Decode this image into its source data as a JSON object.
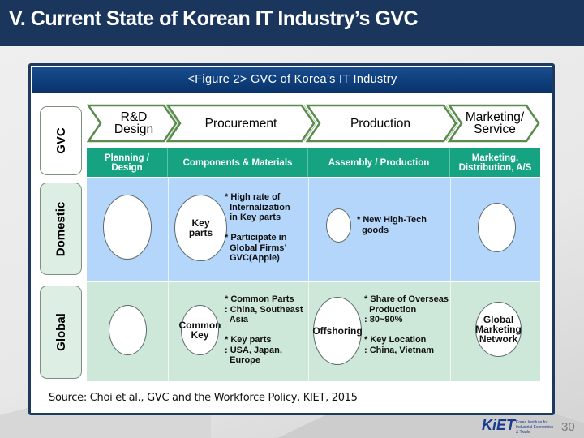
{
  "slide": {
    "title": "V. Current State of Korean IT Industry’s GVC",
    "page_number": "30"
  },
  "figure": {
    "title": "<Figure 2> GVC of Korea’s IT Industry",
    "row_labels": {
      "gvc": "GVC",
      "domestic": "Domestic",
      "global": "Global"
    },
    "stages": [
      {
        "label": "R&D\nDesign"
      },
      {
        "label": "Procurement"
      },
      {
        "label": "Production"
      },
      {
        "label": "Marketing/\nService"
      }
    ],
    "column_headers": [
      "Planning /\nDesign",
      "Components & Materials",
      "Assembly / Production",
      "Marketing,\nDistribution, A/S"
    ],
    "domestic": {
      "procurement_ellipse": "Key\nparts",
      "procurement_note": "* High rate of\n  Internalization\n  in Key parts\n\n* Participate in\n  Global Firms’\n  GVC(Apple)",
      "production_note": "* New High-Tech\n  goods"
    },
    "global": {
      "procurement_ellipse": "Common\nKey",
      "procurement_note": "* Common Parts\n: China, Southeast\n  Asia\n\n* Key parts\n: USA, Japan,\n  Europe",
      "production_ellipse": "Offshoring",
      "production_note": "* Share of Overseas\n  Production\n: 80~90%\n\n* Key Location\n: China, Vietnam",
      "marketing_ellipse": "Global\nMarketing\nNetwork"
    },
    "source": "Source: Choi et al., GVC and the Workforce Policy, KIET, 2015"
  },
  "logo": {
    "name": "KiET",
    "subtitle": "Korea Institute for Industrial Economics & Trade"
  },
  "colors": {
    "title_bar": "#1b365d",
    "figure_header": "#0d3d7a",
    "column_header": "#15a382",
    "domestic_band": "#b5d6fb",
    "global_band": "#cde8d9",
    "chevron_border": "#5a8a4e"
  }
}
